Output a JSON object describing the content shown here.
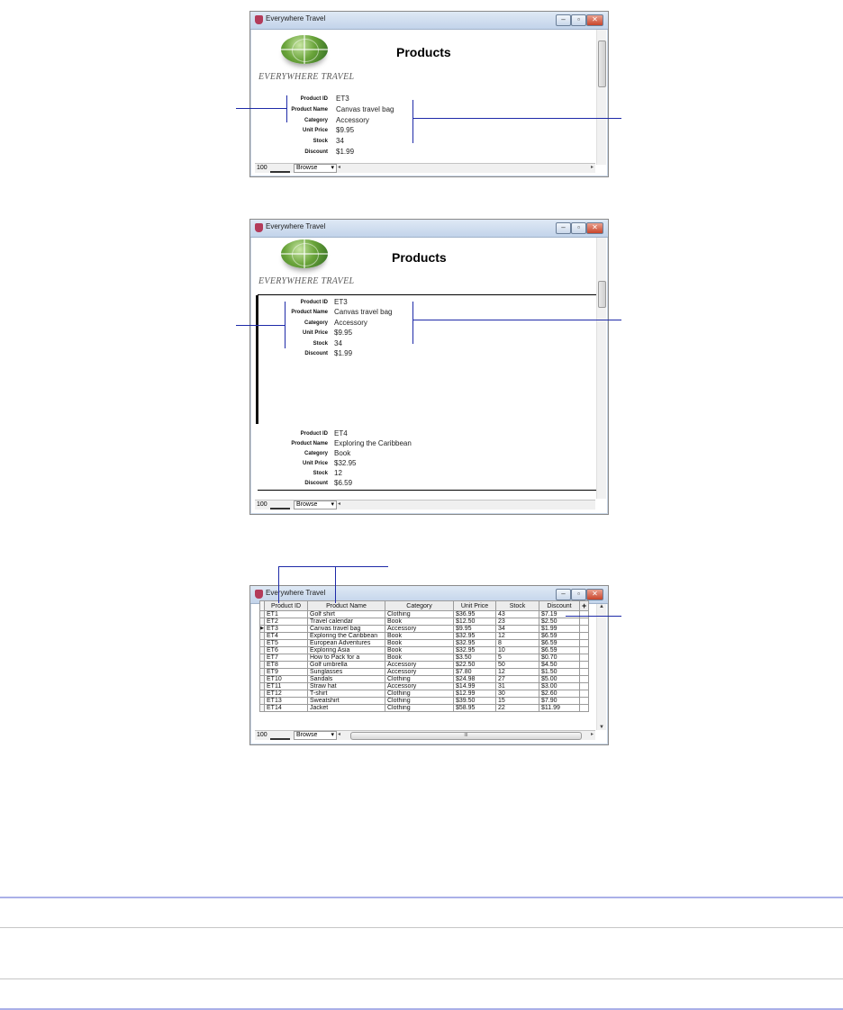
{
  "app": {
    "window_title_1": "Everywhere Travel",
    "window_title_2": "Everywhere Travel",
    "window_title_3": "Everywhere Travel",
    "minimize": "–",
    "restore": "▫",
    "close": "✕"
  },
  "brand": {
    "logo_text": "EVERYWHERE TRAVEL"
  },
  "form": {
    "heading": "Products",
    "labels": {
      "product_id": "Product ID",
      "product_name": "Product Name",
      "category": "Category",
      "unit_price": "Unit Price",
      "stock": "Stock",
      "discount": "Discount"
    }
  },
  "record_et3": {
    "product_id": "ET3",
    "product_name": "Canvas travel bag",
    "category": "Accessory",
    "unit_price": "$9.95",
    "stock": "34",
    "discount": "$1.99"
  },
  "record_et4": {
    "product_id": "ET4",
    "product_name": "Exploring the Caribbean",
    "category": "Book",
    "unit_price": "$32.95",
    "stock": "12",
    "discount": "$6.59"
  },
  "statusbar": {
    "zoom": "100",
    "mode": "Browse",
    "mode_arrow": "▾",
    "scroll_left": "◂",
    "scroll_right": "▸",
    "thumb_grip": "III"
  },
  "table": {
    "add_column": "+",
    "headers": [
      "Product ID",
      "Product Name",
      "Category",
      "Unit Price",
      "Stock",
      "Discount"
    ],
    "rows": [
      [
        "ET1",
        "Golf shirt",
        "Clothing",
        "$36.95",
        "43",
        "$7.19"
      ],
      [
        "ET2",
        "Travel calendar",
        "Book",
        "$12.50",
        "23",
        "$2.50"
      ],
      [
        "ET3",
        "Canvas travel bag",
        "Accessory",
        "$9.95",
        "34",
        "$1.99"
      ],
      [
        "ET4",
        "Exploring the Caribbean",
        "Book",
        "$32.95",
        "12",
        "$6.59"
      ],
      [
        "ET5",
        "European Adventures",
        "Book",
        "$32.95",
        "8",
        "$6.59"
      ],
      [
        "ET6",
        "Exploring Asia",
        "Book",
        "$32.95",
        "10",
        "$6.59"
      ],
      [
        "ET7",
        "How to Pack for a",
        "Book",
        "$3.50",
        "5",
        "$0.70"
      ],
      [
        "ET8",
        "Golf umbrella",
        "Accessory",
        "$22.50",
        "50",
        "$4.50"
      ],
      [
        "ET9",
        "Sunglasses",
        "Accessory",
        "$7.80",
        "12",
        "$1.50"
      ],
      [
        "ET10",
        "Sandals",
        "Clothing",
        "$24.98",
        "27",
        "$5.00"
      ],
      [
        "ET11",
        "Straw hat",
        "Accessory",
        "$14.99",
        "31",
        "$3.00"
      ],
      [
        "ET12",
        "T-shirt",
        "Clothing",
        "$12.99",
        "30",
        "$2.60"
      ],
      [
        "ET13",
        "Sweatshirt",
        "Clothing",
        "$39.50",
        "15",
        "$7.90"
      ],
      [
        "ET14",
        "Jacket",
        "Clothing",
        "$58.95",
        "22",
        "$11.99"
      ]
    ],
    "selected_row_index": 2,
    "row_marker": "▶"
  },
  "colors": {
    "callout_line": "#1e2aa8",
    "page_rule_top": "#aab0e8",
    "page_rule": "#c6c6c6"
  }
}
